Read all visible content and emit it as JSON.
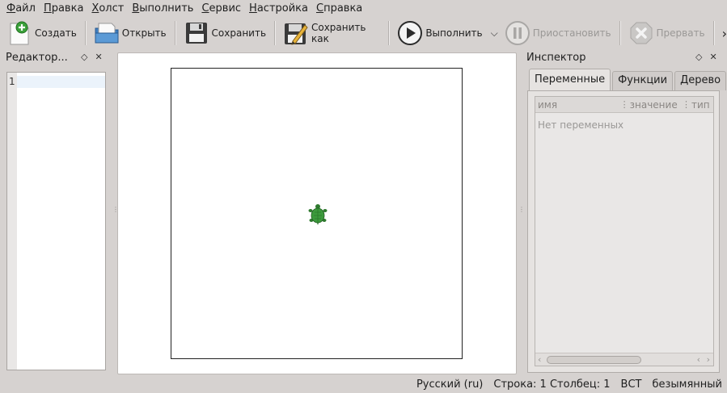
{
  "menu": [
    "Файл",
    "Правка",
    "Холст",
    "Выполнить",
    "Сервис",
    "Настройка",
    "Справка"
  ],
  "toolbar": {
    "new_label": "Создать",
    "open_label": "Открыть",
    "save_label": "Сохранить",
    "save_as_label": "Сохранить как",
    "run_label": "Выполнить",
    "pause_label": "Приостановить",
    "abort_label": "Прервать",
    "more_label": "›"
  },
  "editor": {
    "title": "Редактор...",
    "line_number": "1"
  },
  "inspector": {
    "title": "Инспектор",
    "tabs": [
      "Переменные",
      "Функции",
      "Дерево"
    ],
    "columns": [
      "имя",
      "значение",
      "тип"
    ],
    "empty_text": "Нет переменных"
  },
  "dock": {
    "float_icon": "◇",
    "close_icon": "✕"
  },
  "statusbar": {
    "language": "Русский (ru)",
    "position": "Строка: 1 Столбец: 1",
    "mode": "ВСТ",
    "filename": "безымянный"
  },
  "colors": {
    "background": "#d6d2d0",
    "turtle_green": "#3c9a3c"
  }
}
